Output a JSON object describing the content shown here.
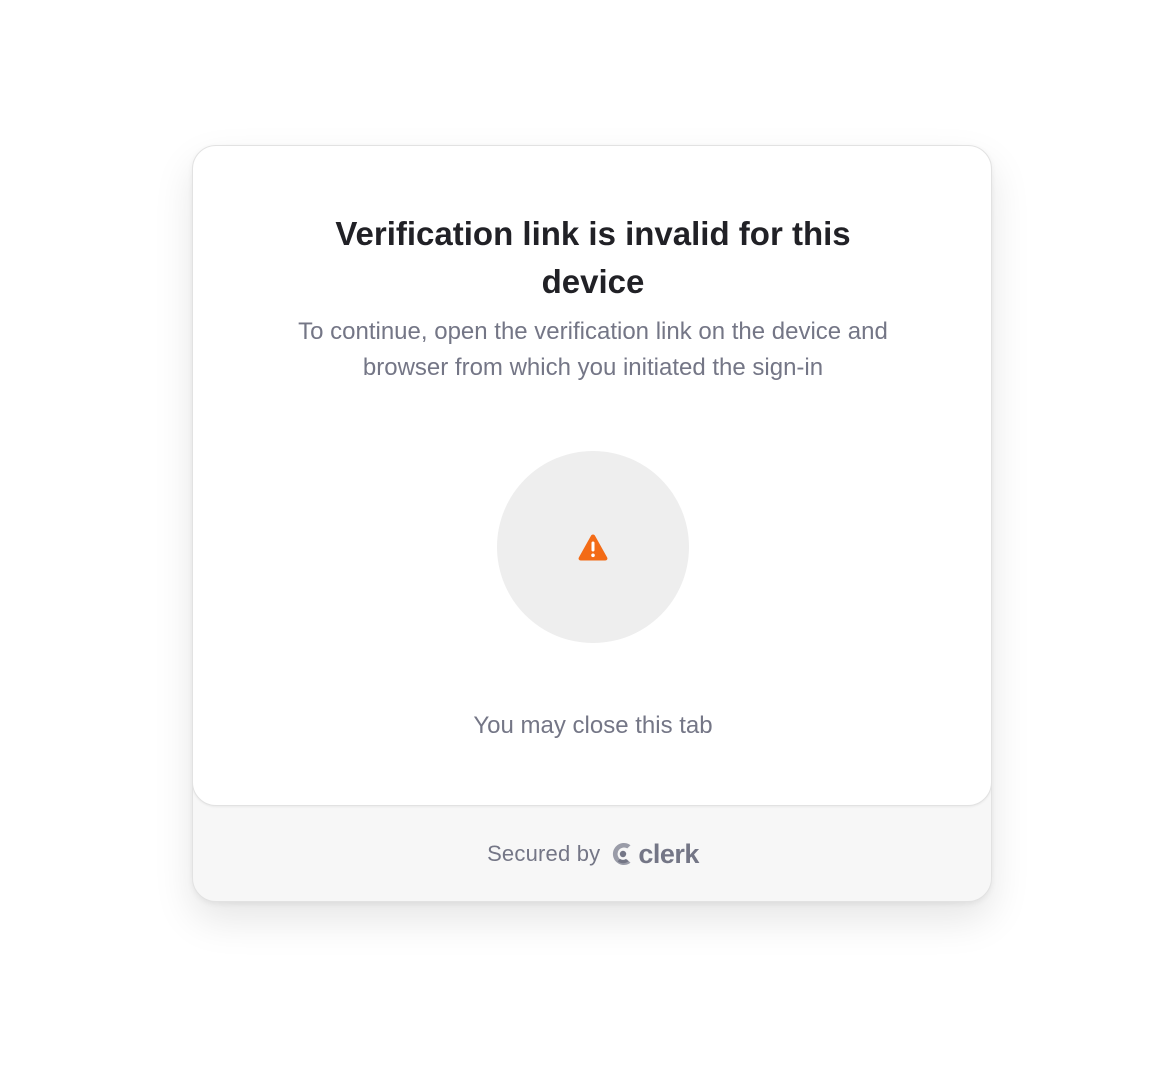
{
  "card": {
    "title": "Verification link is invalid for this device",
    "subtitle": "To continue, open the verification link on the device and browser from which you initiated the sign-in",
    "status_icon": "warning-icon",
    "close_hint": "You may close this tab"
  },
  "footer": {
    "secured_by": "Secured by",
    "brand_icon": "clerk-logo-icon",
    "brand_name": "clerk"
  },
  "colors": {
    "warning": "#F36B16",
    "muted_text": "#747686",
    "heading_text": "#212126",
    "circle_bg": "#EEEEEE",
    "footer_bg": "#F7F7F7"
  }
}
